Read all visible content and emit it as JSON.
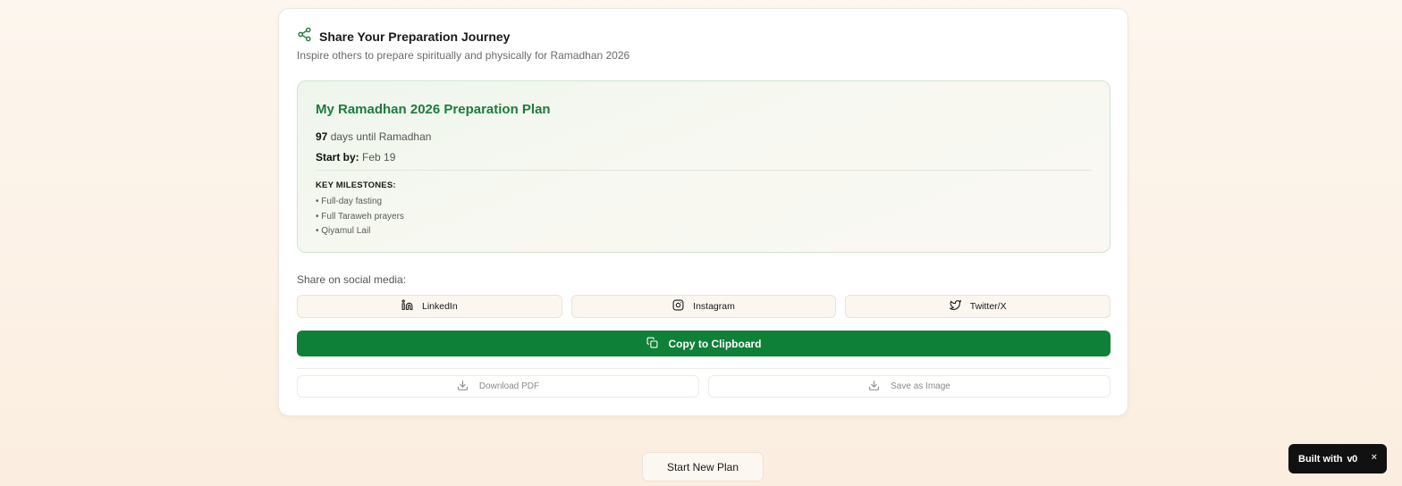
{
  "card": {
    "title": "Share Your Preparation Journey",
    "subtitle": "Inspire others to prepare spiritually and physically for Ramadhan 2026",
    "header_icon": "share-icon"
  },
  "plan": {
    "title": "My Ramadhan 2026 Preparation Plan",
    "days_count": "97",
    "days_text": " days until Ramadhan",
    "start_label": "Start by:",
    "start_value": " Feb 19",
    "milestones_title": "KEY MILESTONES:",
    "milestones": [
      "• Full-day fasting",
      "• Full Taraweh prayers",
      "• Qiyamul Lail"
    ]
  },
  "share": {
    "label": "Share on social media:",
    "buttons": [
      {
        "label": "LinkedIn",
        "icon": "linkedin-icon"
      },
      {
        "label": "Instagram",
        "icon": "instagram-icon"
      },
      {
        "label": "Twitter/X",
        "icon": "twitter-icon"
      }
    ],
    "copy_label": "Copy to Clipboard",
    "copy_icon": "copy-icon"
  },
  "export": {
    "pdf_label": "Download PDF",
    "image_label": "Save as Image",
    "icon": "download-icon"
  },
  "footer": {
    "new_plan_label": "Start New Plan"
  },
  "badge": {
    "text": "Built with",
    "logo": "v0",
    "close": "×"
  },
  "colors": {
    "accent_green": "#0f8038",
    "title_green": "#1f7a3f",
    "background": "#fdf6ee"
  }
}
